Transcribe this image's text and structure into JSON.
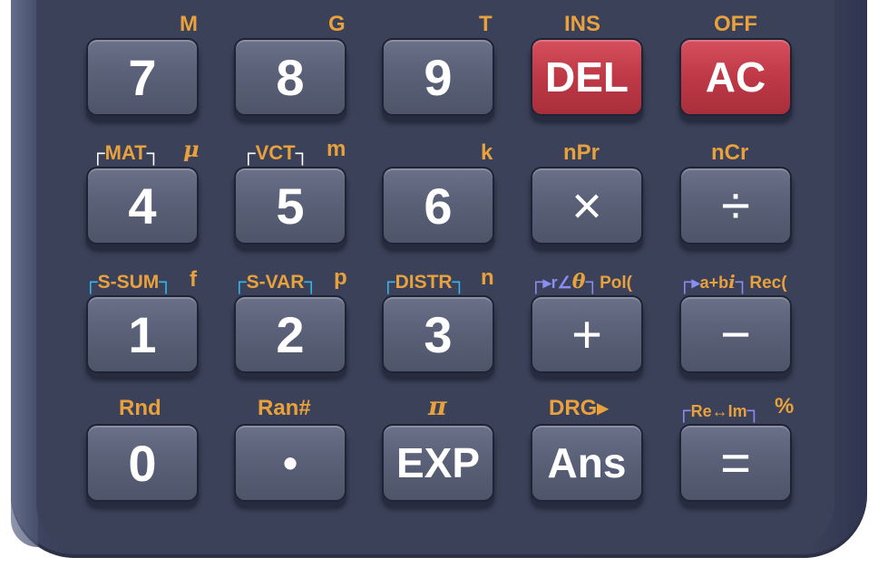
{
  "row1": {
    "k7": {
      "label": "7",
      "shift": "M"
    },
    "k8": {
      "label": "8",
      "shift": "G"
    },
    "k9": {
      "label": "9",
      "shift": "T"
    },
    "del": {
      "label": "DEL",
      "shift": "INS"
    },
    "ac": {
      "label": "AC",
      "shift": "OFF"
    }
  },
  "row2": {
    "k4": {
      "label": "4",
      "mode_label": "MAT",
      "shift": "μ"
    },
    "k5": {
      "label": "5",
      "mode_label": "VCT",
      "shift": "m"
    },
    "k6": {
      "label": "6",
      "shift": "k"
    },
    "mul": {
      "label": "×",
      "shift": "nPr"
    },
    "div": {
      "label": "÷",
      "shift": "nCr"
    }
  },
  "row3": {
    "k1": {
      "label": "1",
      "mode_label": "S-SUM",
      "shift": "f"
    },
    "k2": {
      "label": "2",
      "mode_label": "S-VAR",
      "shift": "p"
    },
    "k3": {
      "label": "3",
      "mode_label": "DISTR",
      "shift": "n"
    },
    "plus": {
      "label": "+",
      "mode_arrow": "▸r∠",
      "mode_theta": "θ",
      "shift": "Pol("
    },
    "minus": {
      "label": "−",
      "mode_arrow": "▸",
      "mode_text": "a+b",
      "mode_i": "i",
      "shift": "Rec("
    }
  },
  "row4": {
    "k0": {
      "label": "0",
      "shift": "Rnd"
    },
    "dot": {
      "label": "•",
      "shift": "Ran#"
    },
    "exp": {
      "label": "EXP",
      "shift": "π"
    },
    "ans": {
      "label": "Ans",
      "shift": "DRG▸"
    },
    "eq": {
      "label": "=",
      "mode_label": "Re↔Im",
      "shift": "%"
    }
  },
  "colors": {
    "body": "#3a4159",
    "key_gray": "#5b6279",
    "key_red": "#c13a48",
    "shift_label": "#e8a13c",
    "bracket_cyan": "#35b8ec",
    "bracket_lavender": "#8a8ef0"
  }
}
